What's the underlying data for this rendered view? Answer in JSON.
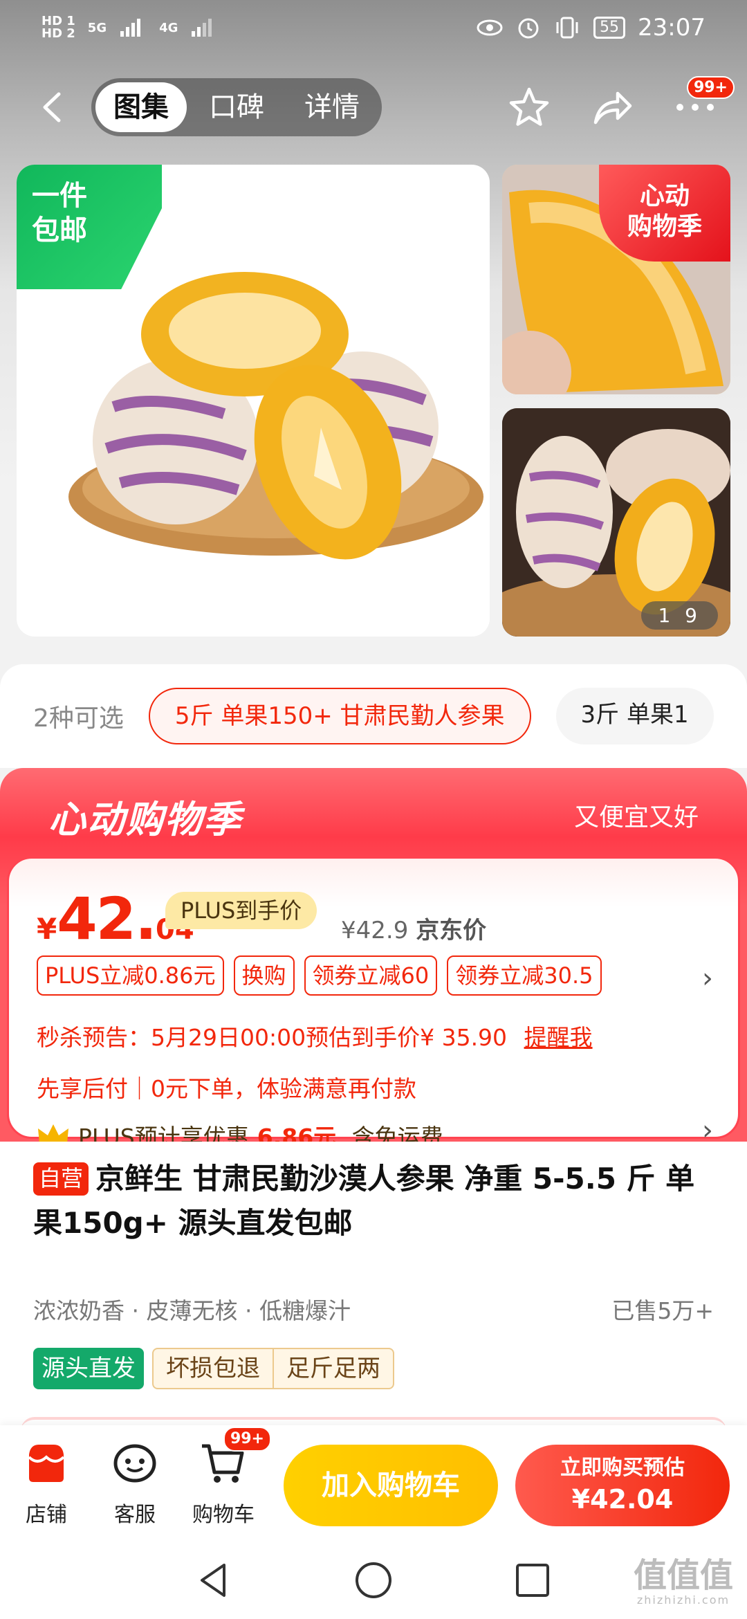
{
  "status_bar": {
    "hd1": "HD 1",
    "hd2": "HD 2",
    "net1": "5G",
    "net2": "4G",
    "battery": "55",
    "time": "23:07"
  },
  "header": {
    "tabs": [
      {
        "label": "图集",
        "active": true
      },
      {
        "label": "口碑",
        "active": false
      },
      {
        "label": "详情",
        "active": false
      }
    ],
    "more_badge": "99+",
    "icons": [
      "back-arrow-icon",
      "star-icon",
      "share-icon",
      "more-icon"
    ]
  },
  "gallery": {
    "free_shipping_line1": "一件",
    "free_shipping_line2": "包邮",
    "event_tag_line1": "心动",
    "event_tag_line2": "购物季",
    "counter_current": "1",
    "counter_total": "9"
  },
  "options": {
    "count_label": "2种可选",
    "chips": [
      {
        "label": "5斤 单果150+ 甘肃民勤人参果",
        "selected": true
      },
      {
        "label": "3斤 单果1",
        "selected": false
      }
    ]
  },
  "promo": {
    "title": "心动购物季",
    "subtitle": "又便宜又好",
    "price_symbol": "¥",
    "price_int": "42.",
    "price_dec": "04",
    "plus_tag": "PLUS到手价",
    "jd_price": "¥42.9",
    "jd_price_label": "京东价",
    "tags": [
      "PLUS立减0.86元",
      "换购",
      "领券立减60",
      "领券立减30.5"
    ],
    "flash_sale": "秒杀预告：5月29日00:00预估到手价¥ 35.90",
    "remind": "提醒我",
    "pay_later": "先享后付｜0元下单，体验满意再付款",
    "plus_prefix": "PLUS预计享优惠",
    "plus_amount": "6.86元",
    "plus_suffix": ",含免运费"
  },
  "product": {
    "self_tag": "自营",
    "title": "京鲜生 甘肃民勤沙漠人参果 净重 5-5.5 斤 单果150g+ 源头直发包邮",
    "features": "浓浓奶香 · 皮薄无核 · 低糖爆汁",
    "sold": "已售5万+",
    "svc_green": "源头直发",
    "svc_gold": [
      "坏损包退",
      "足斤足两"
    ]
  },
  "action_bar": {
    "shop": "店铺",
    "service": "客服",
    "cart": "购物车",
    "cart_badge": "99+",
    "add_cart": "加入购物车",
    "buy_line1": "立即购买预估",
    "buy_line2": "¥42.04"
  },
  "watermark": {
    "main": "值值值",
    "sub": "zhizhizhi.com"
  },
  "colors": {
    "accent": "#f2270c",
    "gold": "#ffc800",
    "green": "#14a96a"
  }
}
